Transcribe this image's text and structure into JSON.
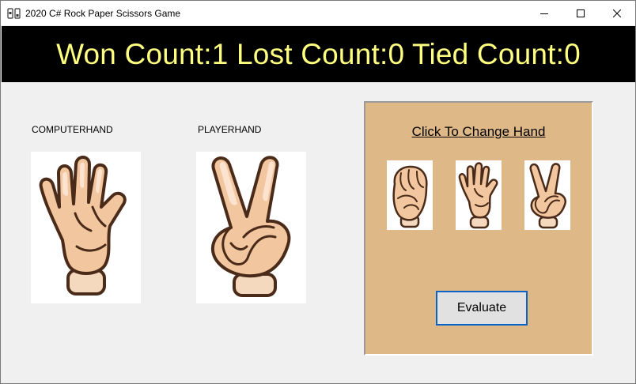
{
  "window": {
    "title": "2020 C# Rock Paper Scissors Game",
    "icon": "app-icon",
    "controls": [
      "minimize-icon",
      "maximize-icon",
      "close-icon"
    ]
  },
  "scoreboard": {
    "text": "Won Count:1 Lost Count:0 Tied Count:0",
    "won": 1,
    "lost": 0,
    "tied": 0,
    "text_color": "#ffff80",
    "background": "#000000"
  },
  "computer": {
    "label": "COMPUTERHAND",
    "hand": "paper-hand-icon"
  },
  "player": {
    "label": "PLAYERHAND",
    "hand": "scissors-hand-icon"
  },
  "panel": {
    "title": "Click To Change Hand",
    "background": "#deb887",
    "choices": [
      "rock-hand-icon",
      "paper-hand-icon",
      "scissors-hand-icon"
    ],
    "evaluate_label": "Evaluate"
  }
}
